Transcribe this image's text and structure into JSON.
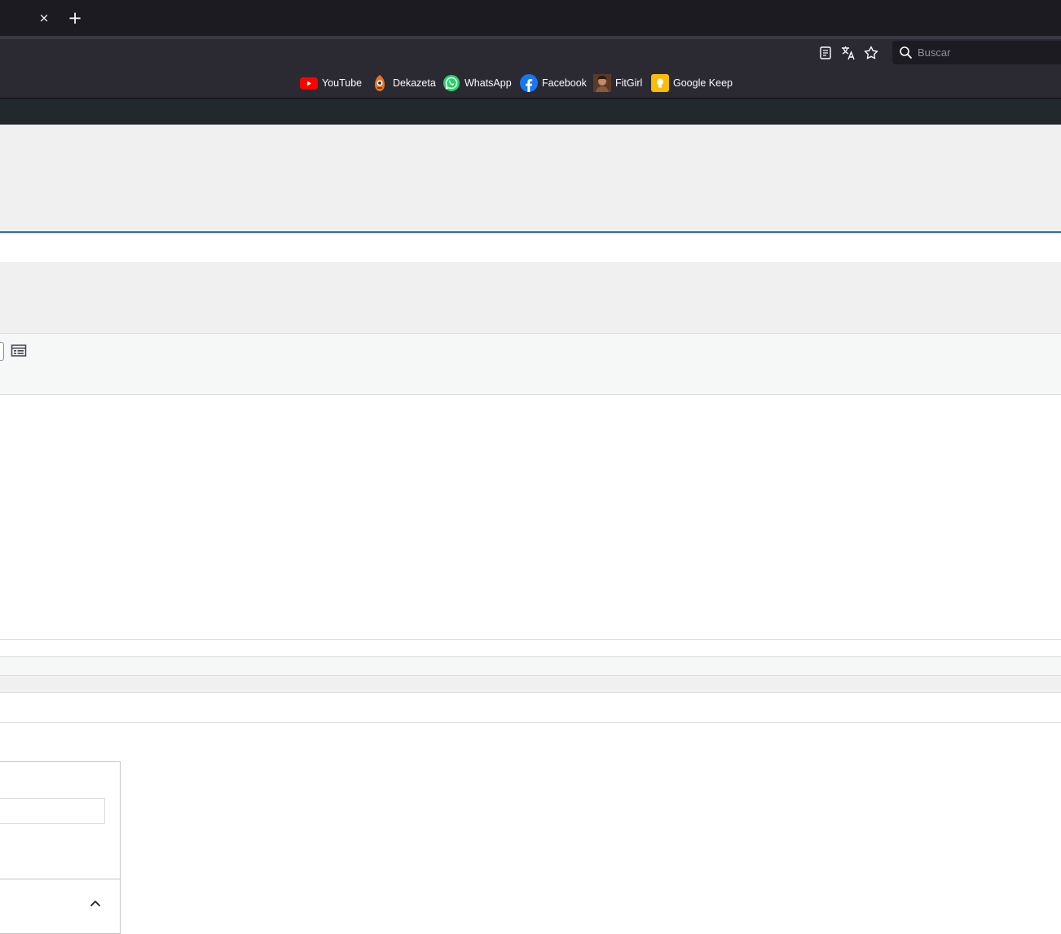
{
  "browser": {
    "tab_close_glyph": "×",
    "new_tab_glyph": "+",
    "toolbar_icons": [
      "reader-view-icon",
      "translate-icon",
      "bookmark-star-icon"
    ],
    "search": {
      "placeholder": "Buscar"
    },
    "bookmarks": [
      {
        "label": "YouTube",
        "icon": "youtube-icon",
        "color": "#ff0000"
      },
      {
        "label": "Dekazeta",
        "icon": "dekazeta-icon",
        "color": "#e0762a"
      },
      {
        "label": "WhatsApp",
        "icon": "whatsapp-icon",
        "color": "#25d366"
      },
      {
        "label": "Facebook",
        "icon": "facebook-icon",
        "color": "#1877f2"
      },
      {
        "label": "FitGirl",
        "icon": "fitgirl-icon",
        "color": "#8a5a3c"
      },
      {
        "label": "Google Keep",
        "icon": "google-keep-icon",
        "color": "#fbbc04"
      }
    ]
  },
  "colors": {
    "accent": "#2271b1",
    "admin_bar": "#23282d",
    "chrome_dark": "#1c1b22",
    "chrome": "#2b2a33"
  },
  "page": {
    "title_input_value": "",
    "metabox_input_value": "",
    "metabox_toggle_icon": "chevron-up-icon"
  }
}
